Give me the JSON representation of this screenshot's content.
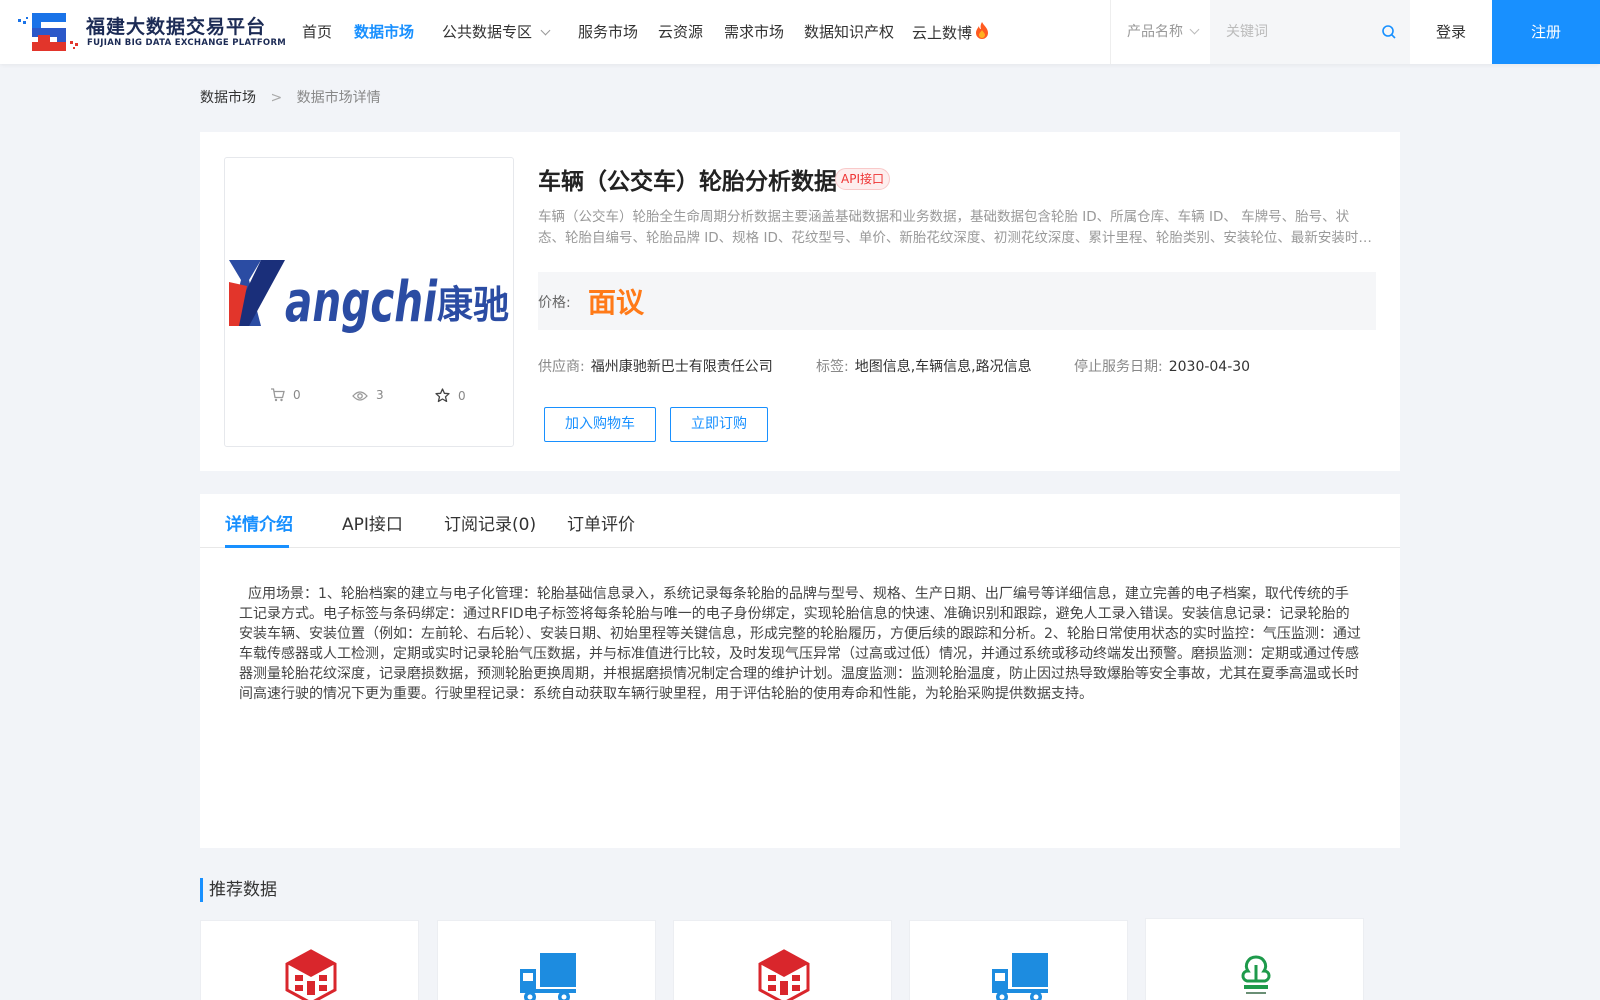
{
  "header": {
    "logo_cn": "福建大数据交易平台",
    "logo_en": "FUJIAN BIG DATA EXCHANGE  PLATFORM",
    "nav": [
      {
        "label": "首页"
      },
      {
        "label": "数据市场"
      },
      {
        "label": "公共数据专区"
      },
      {
        "label": "服务市场"
      },
      {
        "label": "云资源"
      },
      {
        "label": "需求市场"
      },
      {
        "label": "数据知识产权"
      },
      {
        "label": "云上数博"
      }
    ],
    "search": {
      "select_value": "产品名称",
      "placeholder": "关键词"
    },
    "login_label": "登录",
    "register_label": "注册"
  },
  "breadcrumb": {
    "parent": "数据市场",
    "separator": ">",
    "current": "数据市场详情"
  },
  "product": {
    "title": "车辆（公交车）轮胎分析数据",
    "badge": "API接口",
    "description": "车辆（公交车）轮胎全生命周期分析数据主要涵盖基础数据和业务数据，基础数据包含轮胎 ID、所属仓库、车辆 ID、 车牌号、胎号、状态、轮胎自编号、轮胎品牌 ID、规格 ID、花纹型号、单价、新胎花纹深度、初测花纹深度、累计里程、轮胎类别、安装轮位、最新安装时间等",
    "price_label": "价格:",
    "price_value": "面议",
    "supplier_label": "供应商:",
    "supplier_value": "福州康驰新巴士有限责任公司",
    "tags_label": "标签:",
    "tags_value": "地图信息,车辆信息,路况信息",
    "stop_label": "停止服务日期:",
    "stop_value": "2030-04-30",
    "add_cart_label": "加入购物车",
    "subscribe_label": "立即订购",
    "stats": {
      "cart": "0",
      "views": "3",
      "favorites": "0"
    }
  },
  "tabs": [
    {
      "label": "详情介绍"
    },
    {
      "label": "API接口"
    },
    {
      "label": "订阅记录(0)"
    },
    {
      "label": "订单评价"
    }
  ],
  "detail_text": "应用场景：1、轮胎档案的建立与电子化管理：轮胎基础信息录入，系统记录每条轮胎的品牌与型号、规格、生产日期、出厂编号等详细信息，建立完善的电子档案，取代传统的手工记录方式。电子标签与条码绑定：通过RFID电子标签将每条轮胎与唯一的电子身份绑定，实现轮胎信息的快速、准确识别和跟踪，避免人工录入错误。安装信息记录：记录轮胎的安装车辆、安装位置（例如：左前轮、右后轮）、安装日期、初始里程等关键信息，形成完整的轮胎履历，方便后续的跟踪和分析。2、轮胎日常使用状态的实时监控：气压监测：通过车载传感器或人工检测，定期或实时记录轮胎气压数据，并与标准值进行比较，及时发现气压异常（过高或过低）情况，并通过系统或移动终端发出预警。磨损监测：定期或通过传感器测量轮胎花纹深度，记录磨损数据，预测轮胎更换周期，并根据磨损情况制定合理的维护计划。温度监测：监测轮胎温度，防止因过热导致爆胎等安全事故，尤其在夏季高温或长时间高速行驶的情况下更为重要。行驶里程记录：系统自动获取车辆行驶里程，用于评估轮胎的使用寿命和性能，为轮胎采购提供数据支持。",
  "recommend": {
    "title": "推荐数据",
    "cards": [
      {
        "icon": "red-cube-icon"
      },
      {
        "icon": "blue-truck-icon"
      },
      {
        "icon": "red-cube-icon"
      },
      {
        "icon": "blue-truck-icon"
      },
      {
        "icon": "green-metro-logo-icon"
      }
    ]
  },
  "colors": {
    "primary": "#1890ff",
    "price": "#ff7a18",
    "badge": "#e33333"
  }
}
